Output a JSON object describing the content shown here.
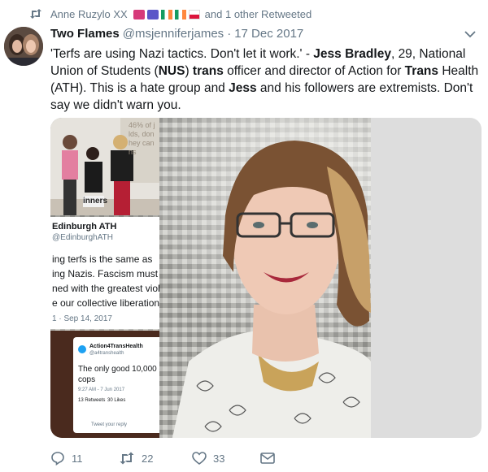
{
  "retweet": {
    "user": "Anne Ruzylo XX",
    "suffix": "and 1 other Retweeted"
  },
  "tweet": {
    "display_name": "Two Flames",
    "handle": "@msjenniferjames",
    "separator": "·",
    "date": "17 Dec 2017",
    "text_parts": [
      {
        "t": "'Terfs are using Nazi tactics. Don't let it work.' - ",
        "b": false
      },
      {
        "t": "Jess Bradley",
        "b": true
      },
      {
        "t": ", 29, National Union of Students (",
        "b": false
      },
      {
        "t": "NUS",
        "b": true
      },
      {
        "t": ") ",
        "b": false
      },
      {
        "t": "trans",
        "b": true
      },
      {
        "t": " officer and director of Action for ",
        "b": false
      },
      {
        "t": "Trans",
        "b": true
      },
      {
        "t": " Health (ATH). This is a hate group and ",
        "b": false
      },
      {
        "t": "Jess",
        "b": true
      },
      {
        "t": " and his followers are extremists. Don't say we didn't warn you.",
        "b": false
      }
    ]
  },
  "media": {
    "embedded": {
      "account": "Edinburgh ATH",
      "handle": "@EdinburghATH",
      "lines": [
        "ing terfs is the same as",
        "ing Nazis. Fascism must b",
        "ned with the greatest violer",
        "e our collective liberation fr"
      ],
      "date": "1 · Sep 14, 2017",
      "slide_text": [
        "46% of j",
        "lds, don",
        "hey can",
        "ns"
      ],
      "shirt_text": "inners",
      "card": {
        "account": "Action4TransHealth",
        "handle": "@a4transhealth",
        "text_line1": "The only good 10,000 co",
        "text_line2": "cops",
        "meta": "9:27 AM - 7 Jun 2017",
        "retweets": "13 Retweets",
        "likes": "30 Likes",
        "reply_placeholder": "Tweet your reply"
      }
    }
  },
  "actions": {
    "replies": "11",
    "retweets": "22",
    "likes": "33"
  },
  "colors": {
    "muted": "#657786",
    "text": "#14171a",
    "link_blue": "#1da1f2"
  },
  "icons": [
    "retweet-icon",
    "caret-down-icon",
    "reply-icon",
    "like-icon",
    "message-icon"
  ]
}
